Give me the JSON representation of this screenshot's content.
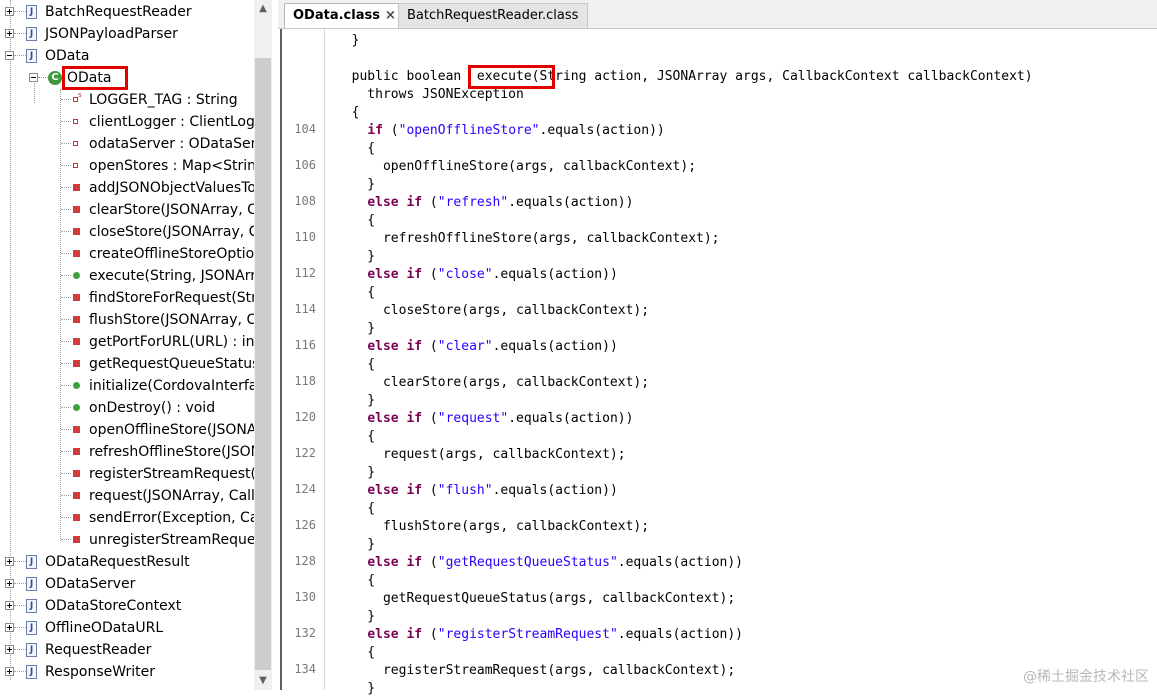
{
  "tree": {
    "items": [
      {
        "label": "BatchRequestReader",
        "kind": "file",
        "expander": "plus"
      },
      {
        "label": "JSONPayloadParser",
        "kind": "file",
        "expander": "plus"
      },
      {
        "label": "OData",
        "kind": "file",
        "expander": "minus"
      },
      {
        "label": "OData",
        "kind": "class",
        "expander": "minus",
        "highlighted": true
      },
      {
        "label": "LOGGER_TAG : String",
        "kind": "static-field"
      },
      {
        "label": "clientLogger : ClientLogg",
        "kind": "field"
      },
      {
        "label": "odataServer : ODataServ",
        "kind": "field"
      },
      {
        "label": "openStores : Map<String",
        "kind": "field"
      },
      {
        "label": "addJSONObjectValuesTo",
        "kind": "private-method"
      },
      {
        "label": "clearStore(JSONArray, Ca",
        "kind": "private-method"
      },
      {
        "label": "closeStore(JSONArray, Ca",
        "kind": "private-method"
      },
      {
        "label": "createOfflineStoreOption",
        "kind": "private-method"
      },
      {
        "label": "execute(String, JSONArra",
        "kind": "public-method"
      },
      {
        "label": "findStoreForRequest(Stri",
        "kind": "private-method"
      },
      {
        "label": "flushStore(JSONArray, Ca",
        "kind": "private-method"
      },
      {
        "label": "getPortForURL(URL) : int",
        "kind": "private-method"
      },
      {
        "label": "getRequestQueueStatus(",
        "kind": "private-method"
      },
      {
        "label": "initialize(CordovaInterfac",
        "kind": "public-method"
      },
      {
        "label": "onDestroy() : void",
        "kind": "public-method"
      },
      {
        "label": "openOfflineStore(JSONA",
        "kind": "private-method"
      },
      {
        "label": "refreshOfflineStore(JSON",
        "kind": "private-method"
      },
      {
        "label": "registerStreamRequest(JS",
        "kind": "private-method"
      },
      {
        "label": "request(JSONArray, Callb",
        "kind": "private-method"
      },
      {
        "label": "sendError(Exception, Call",
        "kind": "private-method"
      },
      {
        "label": "unregisterStreamRequest",
        "kind": "private-method"
      },
      {
        "label": "ODataRequestResult",
        "kind": "file",
        "expander": "plus"
      },
      {
        "label": "ODataServer",
        "kind": "file",
        "expander": "plus"
      },
      {
        "label": "ODataStoreContext",
        "kind": "file",
        "expander": "plus"
      },
      {
        "label": "OfflineODataURL",
        "kind": "file",
        "expander": "plus"
      },
      {
        "label": "RequestReader",
        "kind": "file",
        "expander": "plus"
      },
      {
        "label": "ResponseWriter",
        "kind": "file",
        "expander": "plus"
      }
    ],
    "icons": {
      "file": "java-file-icon",
      "class": "class-icon",
      "field": "field-icon",
      "private-method": "private-method-icon",
      "public-method": "public-method-icon"
    }
  },
  "tabs": [
    {
      "label": "OData.class",
      "active": true,
      "close": "×"
    },
    {
      "label": "BatchRequestReader.class",
      "active": false
    }
  ],
  "code": {
    "lines": [
      {
        "num": "",
        "segs": [
          {
            "t": "  }",
            "c": ""
          }
        ]
      },
      {
        "num": "",
        "segs": [
          {
            "t": "",
            "c": ""
          }
        ]
      },
      {
        "num": "",
        "segs": [
          {
            "t": "  public boolean  execute(String action, JSONArray args, CallbackContext callbackContext)",
            "c": ""
          }
        ]
      },
      {
        "num": "",
        "segs": [
          {
            "t": "    throws JSONException",
            "c": ""
          }
        ]
      },
      {
        "num": "",
        "segs": [
          {
            "t": "  {",
            "c": ""
          }
        ]
      },
      {
        "num": "104",
        "segs": [
          {
            "t": "    ",
            "c": ""
          },
          {
            "t": "if",
            "c": "kw"
          },
          {
            "t": " (",
            "c": ""
          },
          {
            "t": "\"openOfflineStore\"",
            "c": "str"
          },
          {
            "t": ".equals(action))",
            "c": ""
          }
        ]
      },
      {
        "num": "",
        "segs": [
          {
            "t": "    {",
            "c": ""
          }
        ]
      },
      {
        "num": "106",
        "segs": [
          {
            "t": "      openOfflineStore(args, callbackContext);",
            "c": ""
          }
        ]
      },
      {
        "num": "",
        "segs": [
          {
            "t": "    }",
            "c": ""
          }
        ]
      },
      {
        "num": "108",
        "segs": [
          {
            "t": "    ",
            "c": ""
          },
          {
            "t": "else if",
            "c": "kw"
          },
          {
            "t": " (",
            "c": ""
          },
          {
            "t": "\"refresh\"",
            "c": "str"
          },
          {
            "t": ".equals(action))",
            "c": ""
          }
        ]
      },
      {
        "num": "",
        "segs": [
          {
            "t": "    {",
            "c": ""
          }
        ]
      },
      {
        "num": "110",
        "segs": [
          {
            "t": "      refreshOfflineStore(args, callbackContext);",
            "c": ""
          }
        ]
      },
      {
        "num": "",
        "segs": [
          {
            "t": "    }",
            "c": ""
          }
        ]
      },
      {
        "num": "112",
        "segs": [
          {
            "t": "    ",
            "c": ""
          },
          {
            "t": "else if",
            "c": "kw"
          },
          {
            "t": " (",
            "c": ""
          },
          {
            "t": "\"close\"",
            "c": "str"
          },
          {
            "t": ".equals(action))",
            "c": ""
          }
        ]
      },
      {
        "num": "",
        "segs": [
          {
            "t": "    {",
            "c": ""
          }
        ]
      },
      {
        "num": "114",
        "segs": [
          {
            "t": "      closeStore(args, callbackContext);",
            "c": ""
          }
        ]
      },
      {
        "num": "",
        "segs": [
          {
            "t": "    }",
            "c": ""
          }
        ]
      },
      {
        "num": "116",
        "segs": [
          {
            "t": "    ",
            "c": ""
          },
          {
            "t": "else if",
            "c": "kw"
          },
          {
            "t": " (",
            "c": ""
          },
          {
            "t": "\"clear\"",
            "c": "str"
          },
          {
            "t": ".equals(action))",
            "c": ""
          }
        ]
      },
      {
        "num": "",
        "segs": [
          {
            "t": "    {",
            "c": ""
          }
        ]
      },
      {
        "num": "118",
        "segs": [
          {
            "t": "      clearStore(args, callbackContext);",
            "c": ""
          }
        ]
      },
      {
        "num": "",
        "segs": [
          {
            "t": "    }",
            "c": ""
          }
        ]
      },
      {
        "num": "120",
        "segs": [
          {
            "t": "    ",
            "c": ""
          },
          {
            "t": "else if",
            "c": "kw"
          },
          {
            "t": " (",
            "c": ""
          },
          {
            "t": "\"request\"",
            "c": "str"
          },
          {
            "t": ".equals(action))",
            "c": ""
          }
        ]
      },
      {
        "num": "",
        "segs": [
          {
            "t": "    {",
            "c": ""
          }
        ]
      },
      {
        "num": "122",
        "segs": [
          {
            "t": "      request(args, callbackContext);",
            "c": ""
          }
        ]
      },
      {
        "num": "",
        "segs": [
          {
            "t": "    }",
            "c": ""
          }
        ]
      },
      {
        "num": "124",
        "segs": [
          {
            "t": "    ",
            "c": ""
          },
          {
            "t": "else if",
            "c": "kw"
          },
          {
            "t": " (",
            "c": ""
          },
          {
            "t": "\"flush\"",
            "c": "str"
          },
          {
            "t": ".equals(action))",
            "c": ""
          }
        ]
      },
      {
        "num": "",
        "segs": [
          {
            "t": "    {",
            "c": ""
          }
        ]
      },
      {
        "num": "126",
        "segs": [
          {
            "t": "      flushStore(args, callbackContext);",
            "c": ""
          }
        ]
      },
      {
        "num": "",
        "segs": [
          {
            "t": "    }",
            "c": ""
          }
        ]
      },
      {
        "num": "128",
        "segs": [
          {
            "t": "    ",
            "c": ""
          },
          {
            "t": "else if",
            "c": "kw"
          },
          {
            "t": " (",
            "c": ""
          },
          {
            "t": "\"getRequestQueueStatus\"",
            "c": "str"
          },
          {
            "t": ".equals(action))",
            "c": ""
          }
        ]
      },
      {
        "num": "",
        "segs": [
          {
            "t": "    {",
            "c": ""
          }
        ]
      },
      {
        "num": "130",
        "segs": [
          {
            "t": "      getRequestQueueStatus(args, callbackContext);",
            "c": ""
          }
        ]
      },
      {
        "num": "",
        "segs": [
          {
            "t": "    }",
            "c": ""
          }
        ]
      },
      {
        "num": "132",
        "segs": [
          {
            "t": "    ",
            "c": ""
          },
          {
            "t": "else if",
            "c": "kw"
          },
          {
            "t": " (",
            "c": ""
          },
          {
            "t": "\"registerStreamRequest\"",
            "c": "str"
          },
          {
            "t": ".equals(action))",
            "c": ""
          }
        ]
      },
      {
        "num": "",
        "segs": [
          {
            "t": "    {",
            "c": ""
          }
        ]
      },
      {
        "num": "134",
        "segs": [
          {
            "t": "      registerStreamRequest(args, callbackContext);",
            "c": ""
          }
        ]
      },
      {
        "num": "",
        "segs": [
          {
            "t": "    }",
            "c": ""
          }
        ]
      }
    ]
  },
  "watermark": "@稀土掘金技术社区",
  "colors": {
    "highlight": "#e00000",
    "keyword": "#7f0055",
    "string": "#2a00ff"
  }
}
